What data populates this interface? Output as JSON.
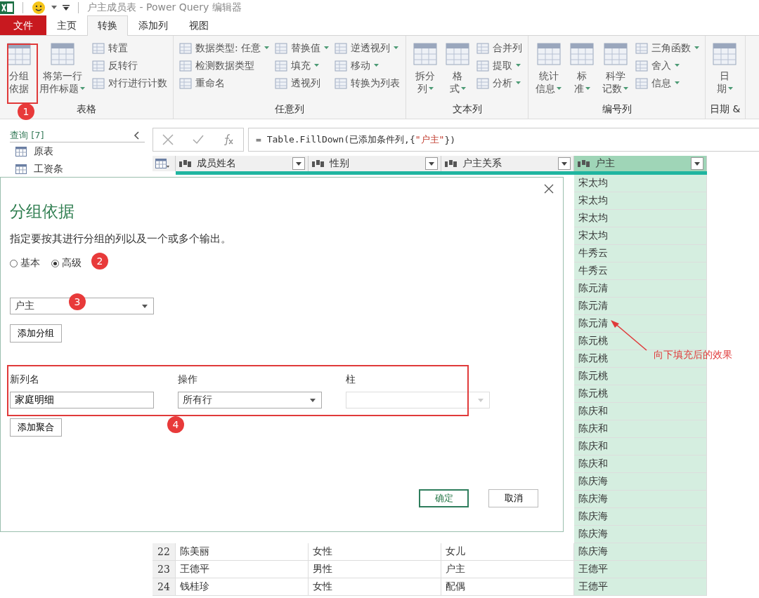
{
  "title_bar": {
    "title": "户主成员表 - Power Query 编辑器"
  },
  "tabs": [
    {
      "label": "文件",
      "kind": "file",
      "selected": false
    },
    {
      "label": "主页",
      "kind": "tab",
      "selected": false
    },
    {
      "label": "转换",
      "kind": "tab",
      "selected": true
    },
    {
      "label": "添加列",
      "kind": "tab",
      "selected": false
    },
    {
      "label": "视图",
      "kind": "tab",
      "selected": false
    }
  ],
  "ribbon": {
    "groups": [
      {
        "label": "表格",
        "items": [
          {
            "kind": "large",
            "lines": [
              "分组",
              "依据"
            ],
            "dropdown": false
          },
          {
            "kind": "large",
            "lines": [
              "将第一行",
              "用作标题"
            ],
            "dropdown": true
          },
          {
            "kind": "stack",
            "entries": [
              {
                "label": "转置",
                "dropdown": false
              },
              {
                "label": "反转行",
                "dropdown": false
              },
              {
                "label": "对行进行计数",
                "dropdown": false
              }
            ]
          }
        ]
      },
      {
        "label": "任意列",
        "items": [
          {
            "kind": "stack",
            "entries": [
              {
                "label": "数据类型: 任意",
                "dropdown": true
              },
              {
                "label": "检测数据类型",
                "dropdown": false
              },
              {
                "label": "重命名",
                "dropdown": false
              }
            ]
          },
          {
            "kind": "stack",
            "entries": [
              {
                "label": "替换值",
                "dropdown": true
              },
              {
                "label": "填充",
                "dropdown": true
              },
              {
                "label": "透视列",
                "dropdown": false
              }
            ]
          },
          {
            "kind": "stack",
            "entries": [
              {
                "label": "逆透视列",
                "dropdown": true
              },
              {
                "label": "移动",
                "dropdown": true
              },
              {
                "label": "转换为列表",
                "dropdown": false
              }
            ]
          }
        ]
      },
      {
        "label": "文本列",
        "items": [
          {
            "kind": "large",
            "lines": [
              "拆分",
              "列"
            ],
            "dropdown": true
          },
          {
            "kind": "large",
            "lines": [
              "格",
              "式"
            ],
            "dropdown": true
          },
          {
            "kind": "stack",
            "entries": [
              {
                "label": "合并列",
                "dropdown": false
              },
              {
                "label": "提取",
                "dropdown": true
              },
              {
                "label": "分析",
                "dropdown": true
              }
            ]
          }
        ]
      },
      {
        "label": "编号列",
        "items": [
          {
            "kind": "large",
            "lines": [
              "统计",
              "信息"
            ],
            "dropdown": true
          },
          {
            "kind": "large",
            "lines": [
              "标",
              "准"
            ],
            "dropdown": true
          },
          {
            "kind": "large",
            "lines": [
              "科学",
              "记数"
            ],
            "dropdown": true
          },
          {
            "kind": "stack",
            "entries": [
              {
                "label": "三角函数",
                "dropdown": true
              },
              {
                "label": "舍入",
                "dropdown": true
              },
              {
                "label": "信息",
                "dropdown": true
              }
            ]
          }
        ]
      },
      {
        "label": "日期 &",
        "items": [
          {
            "kind": "large",
            "lines": [
              "日",
              "期"
            ],
            "dropdown": true
          }
        ]
      }
    ]
  },
  "queries": {
    "header": "查询 [7]",
    "items": [
      "原表",
      "工资条"
    ]
  },
  "formula": {
    "before": "= Table.FillDown(已添加条件列,{",
    "string": "\"户主\"",
    "after": "})"
  },
  "table": {
    "columns": [
      "成员姓名",
      "性别",
      "户主关系",
      "户主"
    ],
    "rows": [
      {
        "head": "宋太均"
      },
      {
        "head": "宋太均"
      },
      {
        "head": "宋太均"
      },
      {
        "head": "宋太均"
      },
      {
        "head": "牛秀云"
      },
      {
        "head": "牛秀云"
      },
      {
        "head": "陈元清"
      },
      {
        "head": "陈元清"
      },
      {
        "head": "陈元清"
      },
      {
        "head": "陈元桃"
      },
      {
        "head": "陈元桃"
      },
      {
        "head": "陈元桃"
      },
      {
        "head": "陈元桃"
      },
      {
        "head": "陈庆和"
      },
      {
        "head": "陈庆和"
      },
      {
        "head": "陈庆和"
      },
      {
        "head": "陈庆和"
      },
      {
        "head": "陈庆海"
      },
      {
        "head": "陈庆海"
      },
      {
        "head": "陈庆海"
      },
      {
        "head": "陈庆海"
      },
      {
        "no": "22",
        "name": "陈美丽",
        "gender": "女性",
        "relation": "女儿",
        "head": "陈庆海"
      },
      {
        "no": "23",
        "name": "王德平",
        "gender": "男性",
        "relation": "户主",
        "head": "王德平"
      },
      {
        "no": "24",
        "name": "钱桂珍",
        "gender": "女性",
        "relation": "配偶",
        "head": "王德平"
      }
    ]
  },
  "dialog": {
    "title": "分组依据",
    "description": "指定要按其进行分组的列以及一个或多个输出。",
    "modes": [
      {
        "label": "基本",
        "selected": false
      },
      {
        "label": "高级",
        "selected": true
      }
    ],
    "group_field": {
      "value": "户主"
    },
    "add_group": "添加分组",
    "labels": [
      "新列名",
      "操作",
      "柱"
    ],
    "new_column": {
      "value": "家庭明细"
    },
    "operation": {
      "value": "所有行"
    },
    "column_field": {
      "disabled": true
    },
    "add_aggregation": "添加聚合",
    "ok": "确定",
    "cancel": "取消"
  },
  "annotations": {
    "markers": [
      "1",
      "2",
      "3",
      "4"
    ],
    "note": "向下填充后的效果"
  }
}
